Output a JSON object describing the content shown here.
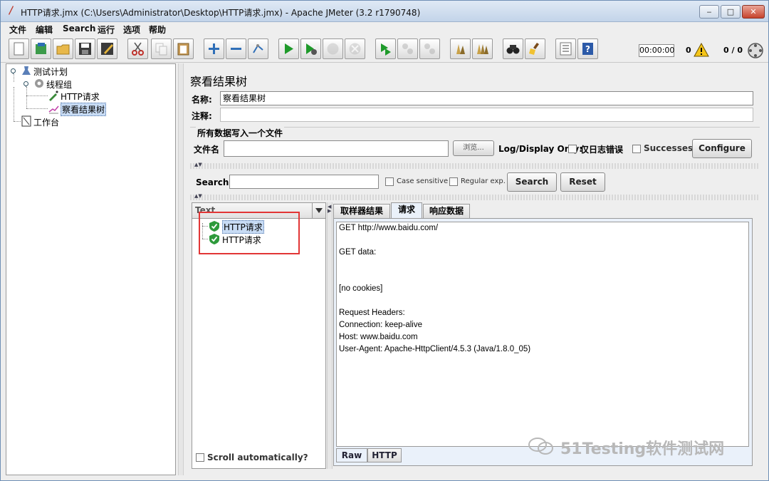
{
  "window": {
    "title": "HTTP请求.jmx (C:\\Users\\Administrator\\Desktop\\HTTP请求.jmx) - Apache JMeter (3.2 r1790748)",
    "minimize": "‒",
    "maximize": "□",
    "close": "✕"
  },
  "menu": [
    "文件",
    "编辑",
    "Search",
    "运行",
    "选项",
    "帮助"
  ],
  "toolbar": {
    "icons": [
      "new-icon",
      "templates-icon",
      "open-icon",
      "save-icon",
      "save-as-icon",
      "cut-icon",
      "copy-icon",
      "paste-icon",
      "expand-icon",
      "collapse-icon",
      "toggle-icon",
      "start-icon",
      "start-no-pause-icon",
      "stop-icon",
      "shutdown-icon",
      "remote-start-icon",
      "remote-stop-icon",
      "remote-shutdown-icon",
      "clear-icon",
      "clear-all-icon",
      "search-icon",
      "reset-search-icon",
      "function-helper-icon",
      "help-icon"
    ],
    "timer": "00:00:00",
    "error_count": "0",
    "threads": "0 / 0"
  },
  "tree": {
    "test_plan": "测试计划",
    "thread_group": "线程组",
    "http_request": "HTTP请求",
    "result_tree": "察看结果树",
    "workbench": "工作台"
  },
  "panel": {
    "title": "察看结果树",
    "name_label": "名称:",
    "name_value": "察看结果树",
    "comment_label": "注释:",
    "comment_value": "",
    "file_section_title": "所有数据写入一个文件",
    "filename_label": "文件名",
    "filename_value": "",
    "browse_button": "浏览...",
    "log_display_label": "Log/Display Only:",
    "errors_only_label": "仅日志错误",
    "successes_label": "Successes",
    "configure_button": "Configure"
  },
  "search": {
    "label": "Search:",
    "value": "",
    "case_sensitive": "Case sensitive",
    "regular_exp": "Regular exp.",
    "search_button": "Search",
    "reset_button": "Reset"
  },
  "results": {
    "renderer": "Text",
    "items": [
      "HTTP请求",
      "HTTP请求"
    ],
    "scroll_auto": "Scroll automatically?"
  },
  "tabs": [
    "取样器结果",
    "请求",
    "响应数据"
  ],
  "request_text": "GET http://www.baidu.com/\n\nGET data:\n\n\n[no cookies]\n\nRequest Headers:\nConnection: keep-alive\nHost: www.baidu.com\nUser-Agent: Apache-HttpClient/4.5.3 (Java/1.8.0_05)",
  "subtabs": [
    "Raw",
    "HTTP"
  ],
  "watermark": "51Testing软件测试网",
  "colors": {
    "selection": "#c8dcf5",
    "highlight_box": "#e23636",
    "run_green": "#1e9a2a"
  }
}
